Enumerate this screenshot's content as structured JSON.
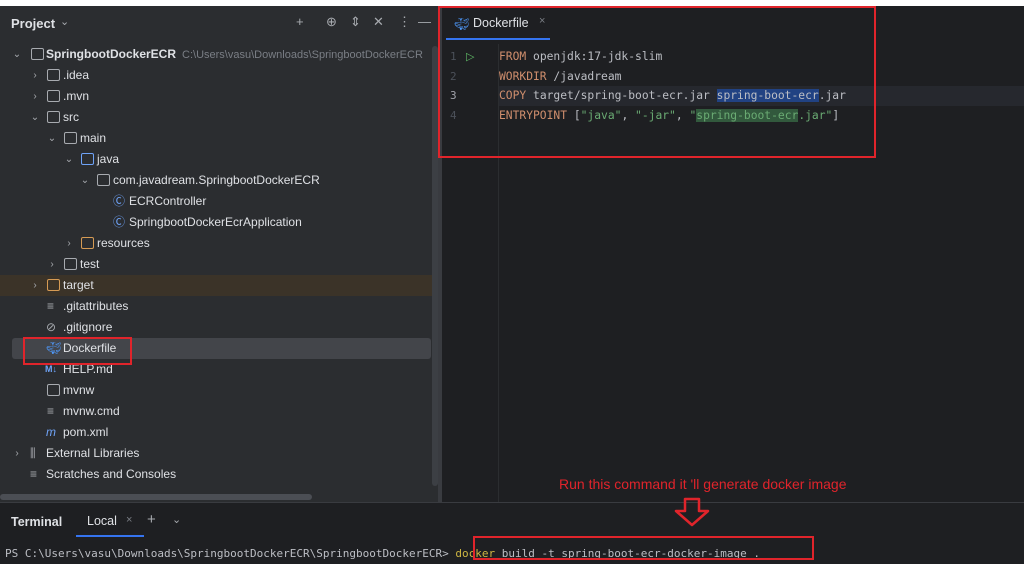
{
  "project": {
    "title": "Project",
    "tools": {
      "add": "+",
      "target": "⊕",
      "expand": "⇕",
      "collapse": "✕",
      "more": "⋮",
      "hide": "—"
    },
    "root": {
      "label": "SpringbootDockerECR",
      "path": "C:\\Users\\vasu\\Downloads\\SpringbootDockerECR"
    },
    "items": [
      {
        "label": ".idea"
      },
      {
        "label": ".mvn"
      },
      {
        "label": "src"
      },
      {
        "label": "main"
      },
      {
        "label": "java"
      },
      {
        "label": "com.javadream.SpringbootDockerECR"
      },
      {
        "label": "ECRController"
      },
      {
        "label": "SpringbootDockerEcrApplication"
      },
      {
        "label": "resources"
      },
      {
        "label": "test"
      },
      {
        "label": "target"
      },
      {
        "label": ".gitattributes"
      },
      {
        "label": ".gitignore"
      },
      {
        "label": "Dockerfile"
      },
      {
        "label": "HELP.md"
      },
      {
        "label": "mvnw"
      },
      {
        "label": "mvnw.cmd"
      },
      {
        "label": "pom.xml"
      },
      {
        "label": "External Libraries"
      },
      {
        "label": "Scratches and Consoles"
      }
    ]
  },
  "editor": {
    "tab": {
      "label": "Dockerfile",
      "close": "×"
    },
    "line_numbers": [
      "1",
      "2",
      "3",
      "4"
    ],
    "code": {
      "l1_kw": "FROM",
      "l1_rest": " openjdk:17-jdk-slim",
      "l2_kw": "WORKDIR",
      "l2_rest": " /javadream",
      "l3_kw": "COPY",
      "l3_a": " target/spring-boot-ecr.jar ",
      "l3_sel": "spring-boot-ecr",
      "l3_b": ".jar",
      "l4_kw": "ENTRYPOINT",
      "l4_a": " [",
      "l4_s1": "\"java\"",
      "l4_c1": ", ",
      "l4_s2": "\"-jar\"",
      "l4_c2": ", ",
      "l4_s3a": "\"",
      "l4_match": "spring-boot-ecr",
      "l4_s3b": ".jar\"",
      "l4_end": "]"
    }
  },
  "terminal": {
    "title": "Terminal",
    "tab_label": "Local",
    "tab_close": "×",
    "add": "+",
    "dropdown": "⌄",
    "prompt": "PS C:\\Users\\vasu\\Downloads\\SpringbootDockerECR\\SpringbootDockerECR> ",
    "cmd_docker": "docker",
    "cmd_rest": " build -t spring-boot-ecr-docker-image ."
  },
  "annotation": {
    "note": "Run this command it 'll generate docker image",
    "color": "#e0242b"
  },
  "colors": {
    "accent": "#3574f0",
    "keyword": "#cf8e6d",
    "string": "#6aab73",
    "annotation": "#e0242b"
  }
}
